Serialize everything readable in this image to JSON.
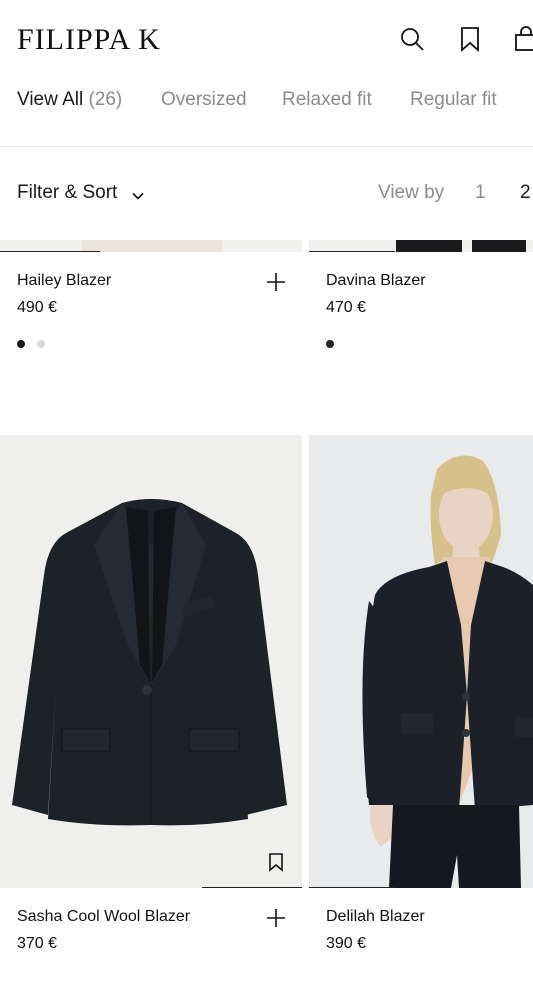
{
  "header": {
    "logo": "FILIPPA K",
    "icons": [
      "search-icon",
      "bookmark-icon",
      "bag-icon"
    ]
  },
  "categories": [
    {
      "label": "View All",
      "count": "(26)",
      "active": true
    },
    {
      "label": "Oversized",
      "count": "",
      "active": false
    },
    {
      "label": "Relaxed fit",
      "count": "",
      "active": false
    },
    {
      "label": "Regular fit",
      "count": "",
      "active": false
    }
  ],
  "toolbar": {
    "filter_label": "Filter & Sort",
    "view_by_label": "View by",
    "view_options": [
      "1",
      "2"
    ]
  },
  "products": [
    {
      "name": "Hailey Blazer",
      "price": "490 €",
      "swatches": [
        "#1a1a1f",
        "#d9d9d9"
      ]
    },
    {
      "name": "Davina Blazer",
      "price": "470 €",
      "swatches": [
        "#2b2424"
      ]
    },
    {
      "name": "Sasha Cool Wool Blazer",
      "price": "370 €",
      "swatches": []
    },
    {
      "name": "Delilah Blazer",
      "price": "390 €",
      "swatches": []
    }
  ],
  "colors": {
    "text": "#111111",
    "muted": "#8b8b8b",
    "image_bg": "#efefed",
    "blazer": "#1d2128"
  }
}
